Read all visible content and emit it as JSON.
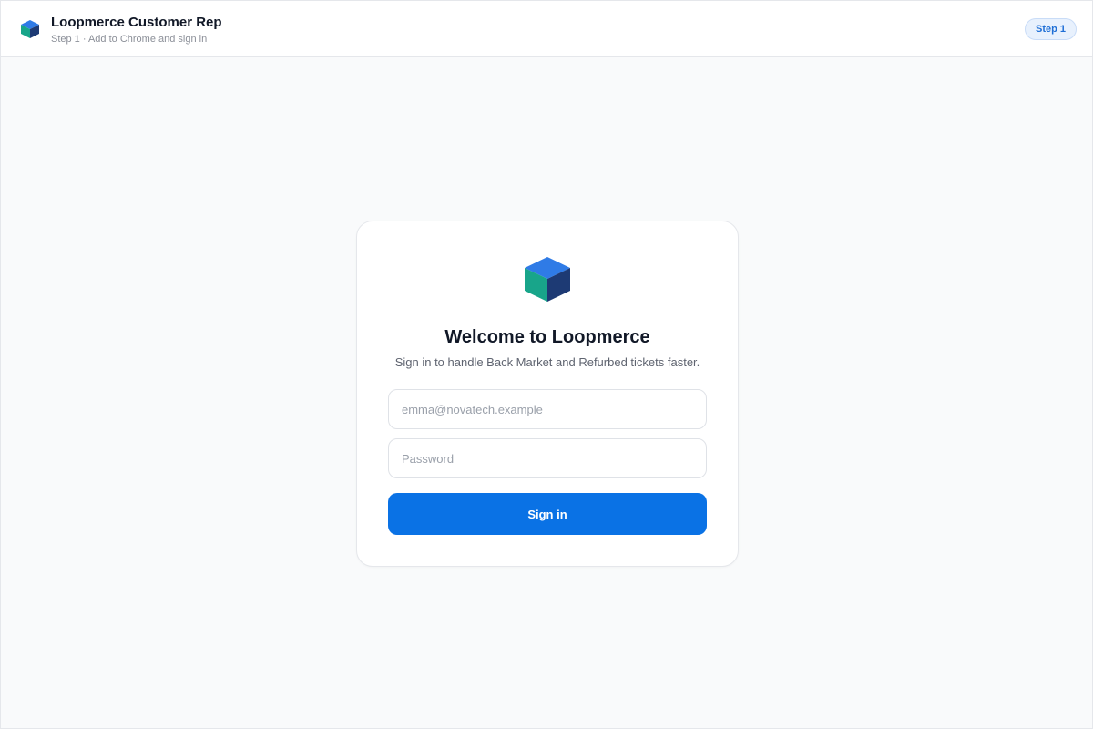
{
  "header": {
    "logo_icon": "cube-logo-icon",
    "title": "Loopmerce Customer Rep",
    "subtitle": "Step 1 · Add to Chrome and sign in",
    "step_badge": "Step 1"
  },
  "login": {
    "logo_icon": "cube-logo-icon",
    "title": "Welcome to Loopmerce",
    "subtitle": "Sign in to handle Back Market and Refurbed tickets faster.",
    "email_value": "",
    "email_placeholder": "emma@novatech.example",
    "password_value": "",
    "password_placeholder": "Password",
    "signin_label": "Sign in"
  },
  "colors": {
    "accent": "#0a72e5",
    "logo_top": "#2f7be6",
    "logo_left": "#18a58a",
    "logo_right": "#1d3a74",
    "badge_background": "#e8f1fd",
    "badge_text": "#1f6fd6"
  }
}
